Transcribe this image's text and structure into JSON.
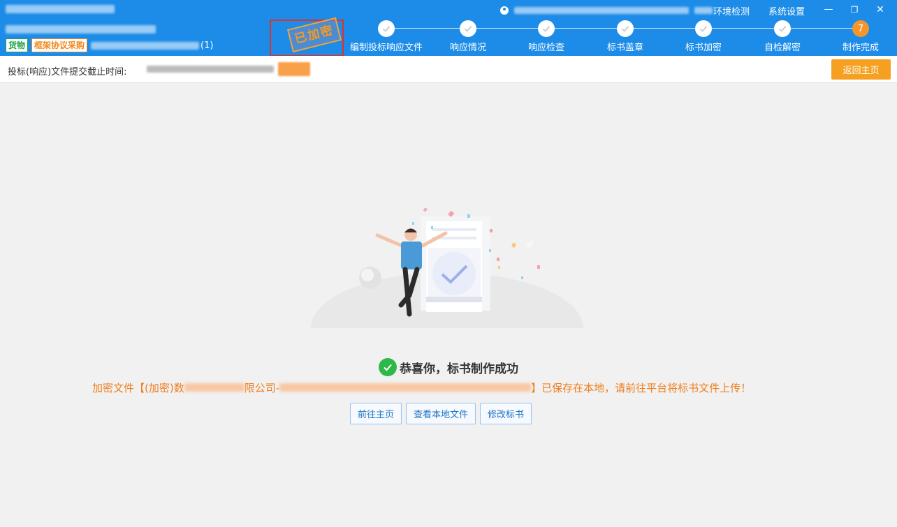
{
  "header": {
    "package_suffix": "(1)",
    "tags": {
      "goods": "货物",
      "framework": "框架协议采购"
    },
    "encrypted_stamp": "已加密",
    "links": {
      "env_check": "环境检测",
      "settings": "系统设置"
    },
    "window_controls": {
      "minimize": "—",
      "restore": "❐",
      "close": "✕"
    }
  },
  "steps": [
    {
      "label": "编制投标响应文件",
      "status": "done"
    },
    {
      "label": "响应情况",
      "status": "done"
    },
    {
      "label": "响应检查",
      "status": "done"
    },
    {
      "label": "标书盖章",
      "status": "done"
    },
    {
      "label": "标书加密",
      "status": "done"
    },
    {
      "label": "自检解密",
      "status": "done"
    },
    {
      "label": "制作完成",
      "status": "current",
      "number": "7"
    }
  ],
  "subbar": {
    "deadline_label": "投标(响应)文件提交截止时间:",
    "return_button": "返回主页"
  },
  "result": {
    "title": "恭喜你，标书制作成功",
    "message_prefix": "加密文件【(加密)数",
    "message_mid": "限公司-",
    "message_suffix": "】已保存在本地，请前往平台将标书文件上传！"
  },
  "actions": [
    {
      "label": "前往主页"
    },
    {
      "label": "查看本地文件"
    },
    {
      "label": "修改标书"
    }
  ],
  "colors": {
    "header_bg": "#1c8ce8",
    "accent_orange": "#f5a020",
    "success_green": "#2fb84a",
    "message_orange": "#f07d1d"
  }
}
